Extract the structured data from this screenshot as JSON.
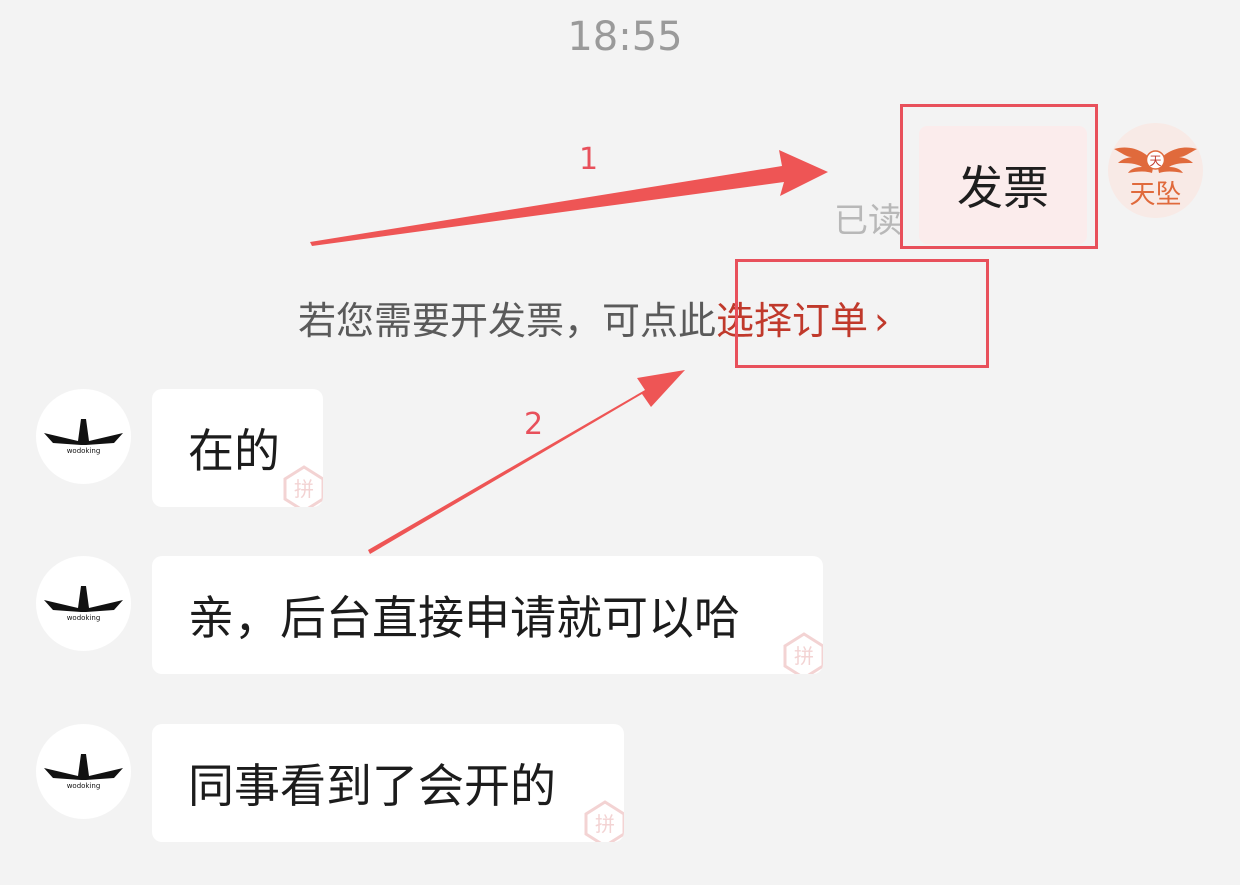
{
  "timestamp": "18:55",
  "outgoing": {
    "text": "发票",
    "read_status": "已读",
    "avatar_text": "天坠",
    "avatar_badge": "天"
  },
  "system_notice": {
    "prefix": "若您需要开发票，可点此",
    "link_label": "选择订单",
    "chevron": "›"
  },
  "incoming": [
    {
      "text": "在的"
    },
    {
      "text": "亲，后台直接申请就可以哈"
    },
    {
      "text": "同事看到了会开的"
    }
  ],
  "shop_avatar_text": "wodoking",
  "watermark_text": "拼",
  "annotations": [
    {
      "number": "1"
    },
    {
      "number": "2"
    }
  ],
  "colors": {
    "annotation": "#e8505b",
    "link": "#c0392b",
    "outgoing_bubble": "#fbecec",
    "background": "#f3f3f3"
  }
}
